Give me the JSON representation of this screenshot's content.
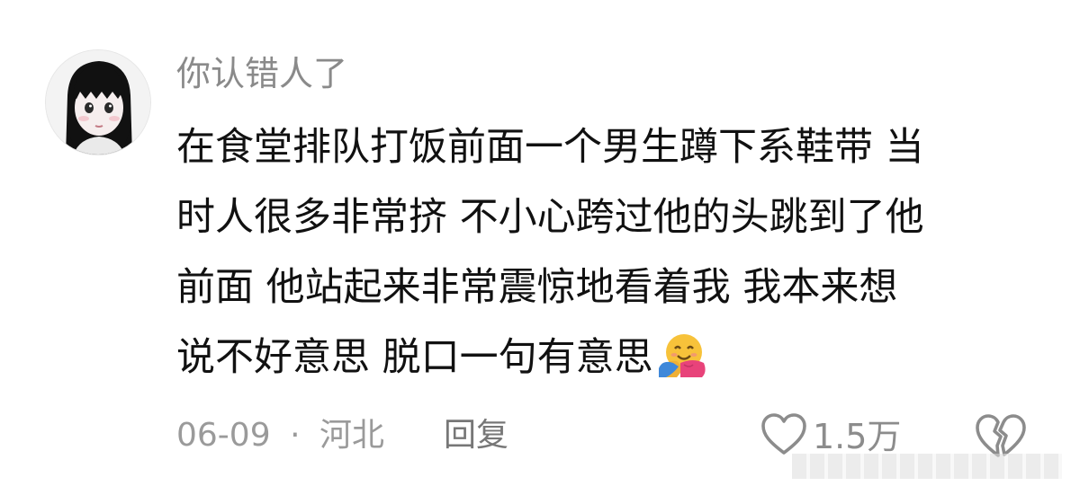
{
  "comment": {
    "username": "你认错人了",
    "lines": [
      "在食堂排队打饭前面一个男生蹲下系鞋带 当",
      "时人很多非常挤 不小心跨过他的头跳到了他",
      "前面 他站起来非常震惊地看着我 我本来想",
      "说不好意思 脱口一句有意思"
    ],
    "emoji": "hugging-face-emoji",
    "date": "06-09",
    "separator": "·",
    "location": "河北",
    "reply_label": "回复",
    "like_count": "1.5万"
  },
  "icons": {
    "like": "heart-outline-icon",
    "dislike": "broken-heart-outline-icon"
  },
  "colors": {
    "username": "#8a8a8a",
    "text": "#111111",
    "meta": "#9a9a9a",
    "icon": "#8c8c8c",
    "emoji_face": "#f7c23a",
    "emoji_hands": "#e8437a"
  }
}
